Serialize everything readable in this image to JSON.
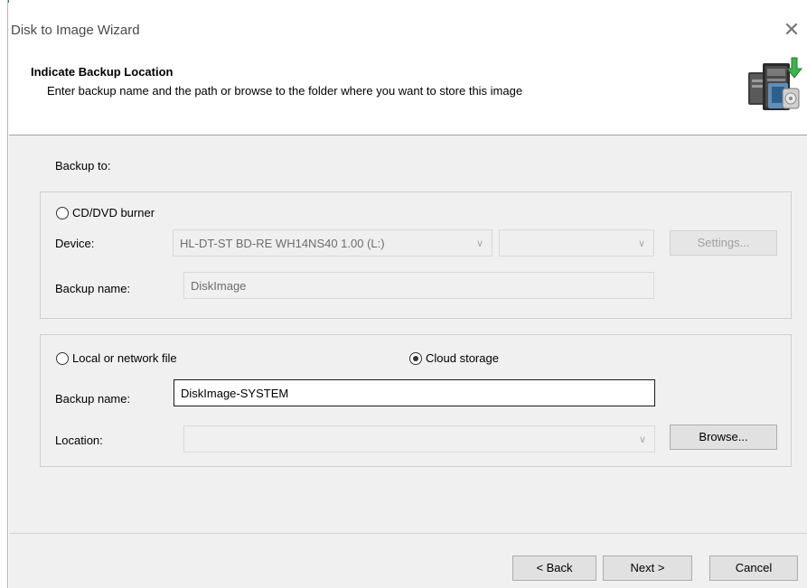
{
  "window": {
    "title": "Disk to Image Wizard",
    "close_glyph": "✕",
    "close_icon": "close-icon"
  },
  "header": {
    "title": "Indicate Backup Location",
    "subtitle": "Enter backup name and the path or browse to the folder where you want to store this image",
    "icon": "backup-wizard-icon"
  },
  "backup_to_label": "Backup to:",
  "cd_group": {
    "radio_label": "CD/DVD burner",
    "selected": false,
    "device_label": "Device:",
    "device_value": "HL-DT-ST BD-RE  WH14NS40  1.00  (L:)",
    "speed_value": "",
    "settings_label": "Settings...",
    "backup_name_label": "Backup name:",
    "backup_name_value": "DiskImage"
  },
  "file_group": {
    "local_radio_label": "Local or network file",
    "local_selected": false,
    "cloud_radio_label": "Cloud storage",
    "cloud_selected": true,
    "backup_name_label": "Backup name:",
    "backup_name_value": "DiskImage-SYSTEM",
    "location_label": "Location:",
    "location_value": "",
    "browse_label": "Browse..."
  },
  "footer": {
    "back_label": "< Back",
    "next_label": "Next >",
    "cancel_label": "Cancel"
  },
  "colors": {
    "accent": "#1f6fd2",
    "panel_bg": "#f0f0f0",
    "disabled_text": "#6d6d6d"
  }
}
